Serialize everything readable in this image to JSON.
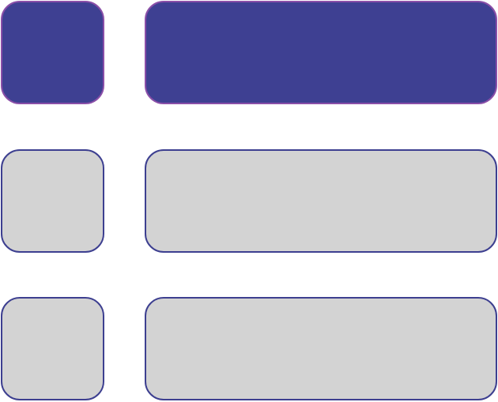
{
  "list_icon": {
    "rows": [
      {
        "state": "selected"
      },
      {
        "state": "unselected"
      },
      {
        "state": "unselected"
      }
    ]
  },
  "colors": {
    "selected_fill": "#3e4092",
    "selected_border": "#8a4fa8",
    "unselected_fill": "#d3d3d3",
    "unselected_border": "#3d3f90",
    "background": "#ffffff"
  }
}
